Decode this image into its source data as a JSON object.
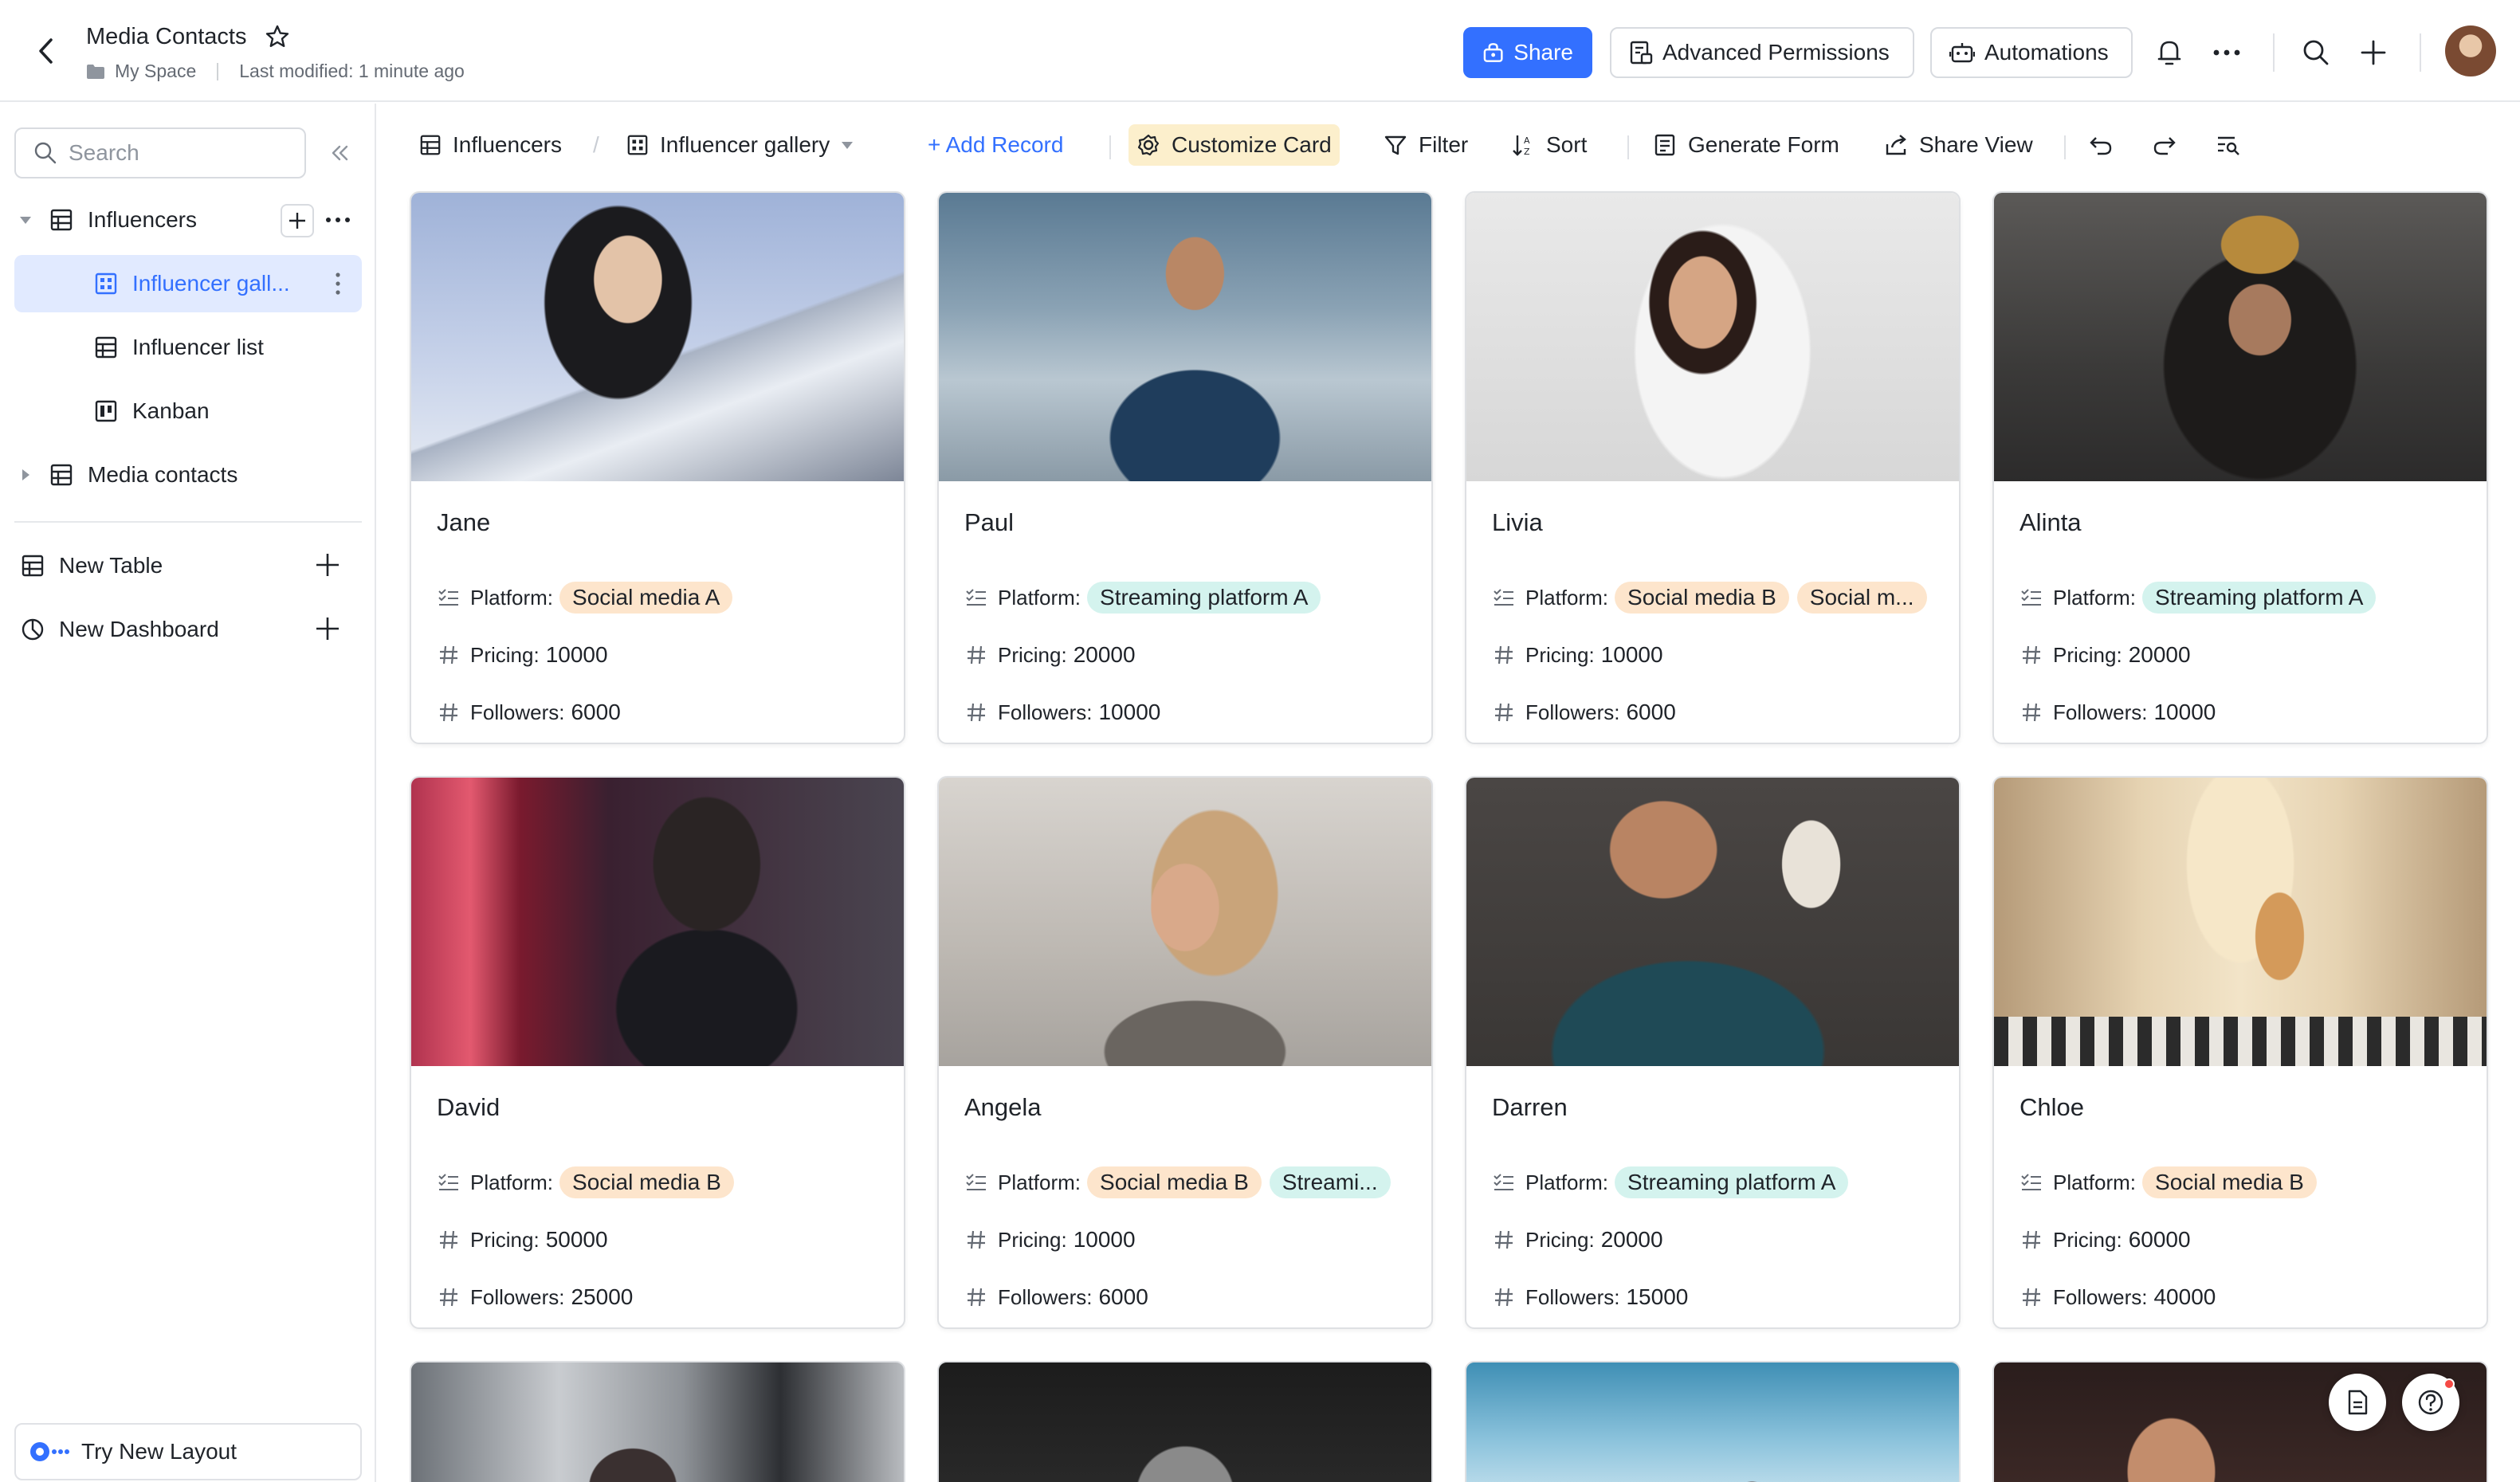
{
  "header": {
    "title": "Media Contacts",
    "location": "My Space",
    "last_modified": "Last modified: 1 minute ago",
    "share_label": "Share",
    "advanced_label": "Advanced Permissions",
    "automations_label": "Automations"
  },
  "sidebar": {
    "search_placeholder": "Search",
    "tree": [
      {
        "label": "Influencers"
      },
      {
        "label": "Influencer gall..."
      },
      {
        "label": "Influencer list"
      },
      {
        "label": "Kanban"
      },
      {
        "label": "Media contacts"
      }
    ],
    "new_table": "New Table",
    "new_dashboard": "New Dashboard",
    "try_layout": "Try New Layout"
  },
  "toolbar": {
    "table_name": "Influencers",
    "view_name": "Influencer gallery",
    "add_record": "+ Add Record",
    "customize_card": "Customize Card",
    "filter": "Filter",
    "sort": "Sort",
    "generate_form": "Generate Form",
    "share_view": "Share View"
  },
  "labels": {
    "platform": "Platform:",
    "pricing": "Pricing:",
    "followers": "Followers:"
  },
  "cards": [
    {
      "name": "Jane",
      "platforms": [
        {
          "text": "Social media A",
          "kind": "social"
        }
      ],
      "pricing": "10000",
      "followers": "6000"
    },
    {
      "name": "Paul",
      "platforms": [
        {
          "text": "Streaming platform A",
          "kind": "stream"
        }
      ],
      "pricing": "20000",
      "followers": "10000"
    },
    {
      "name": "Livia",
      "platforms": [
        {
          "text": "Social media B",
          "kind": "social"
        },
        {
          "text": "Social m...",
          "kind": "social"
        }
      ],
      "pricing": "10000",
      "followers": "6000"
    },
    {
      "name": "Alinta",
      "platforms": [
        {
          "text": "Streaming platform A",
          "kind": "stream"
        }
      ],
      "pricing": "20000",
      "followers": "10000"
    },
    {
      "name": "David",
      "platforms": [
        {
          "text": "Social media B",
          "kind": "social"
        }
      ],
      "pricing": "50000",
      "followers": "25000"
    },
    {
      "name": "Angela",
      "platforms": [
        {
          "text": "Social media B",
          "kind": "social"
        },
        {
          "text": "Streami...",
          "kind": "stream"
        }
      ],
      "pricing": "10000",
      "followers": "6000"
    },
    {
      "name": "Darren",
      "platforms": [
        {
          "text": "Streaming platform A",
          "kind": "stream"
        }
      ],
      "pricing": "20000",
      "followers": "15000"
    },
    {
      "name": "Chloe",
      "platforms": [
        {
          "text": "Social media B",
          "kind": "social"
        }
      ],
      "pricing": "60000",
      "followers": "40000"
    }
  ],
  "colors": {
    "accent": "#3370ff",
    "social_tag": "#fde5cc",
    "stream_tag": "#d4f3ee",
    "customize_bg": "#fcefcc"
  }
}
